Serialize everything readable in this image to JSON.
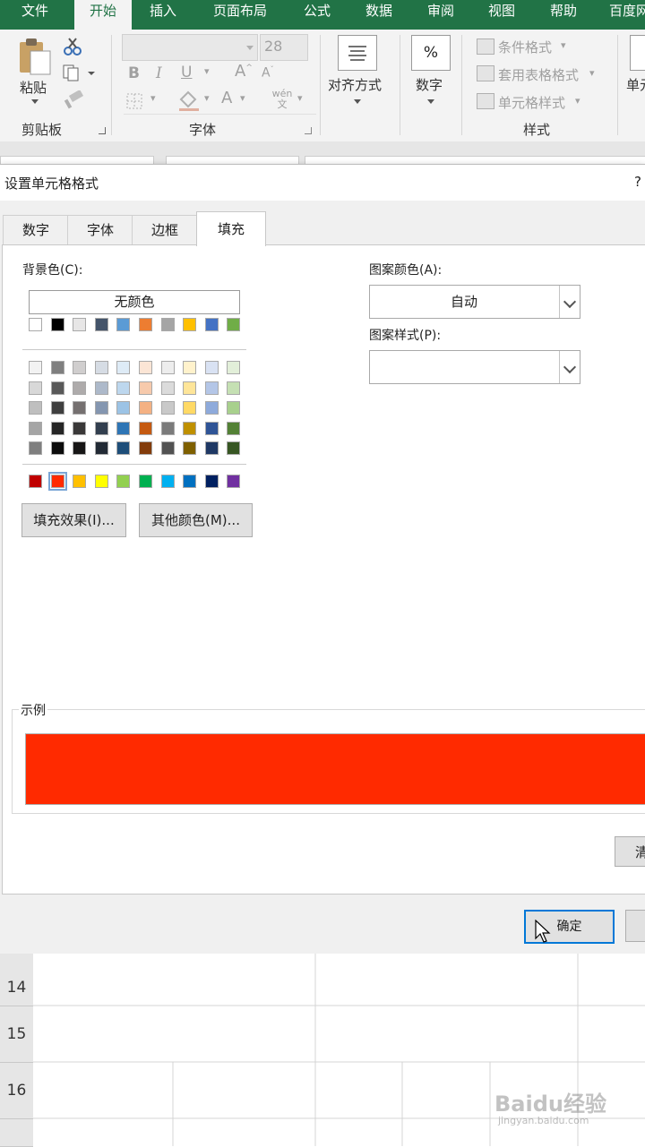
{
  "ribbon": {
    "tabs": [
      "文件",
      "开始",
      "插入",
      "页面布局",
      "公式",
      "数据",
      "审阅",
      "视图",
      "帮助",
      "百度网"
    ],
    "active_tab": "开始",
    "clipboard": {
      "paste_label": "粘贴",
      "group_label": "剪贴板"
    },
    "font": {
      "size_value": "28",
      "group_label": "字体",
      "phonetic_label": "wén 文"
    },
    "alignment": {
      "label": "对齐方式"
    },
    "number": {
      "label": "数字",
      "icon_text": "%"
    },
    "styles": {
      "conditional": "条件格式",
      "table_format": "套用表格格式",
      "cell_styles": "单元格样式",
      "group_label": "样式"
    },
    "cells_partial": "单元"
  },
  "dialog": {
    "title": "设置单元格格式",
    "help": "?",
    "tabs": [
      "数字",
      "字体",
      "边框",
      "填充"
    ],
    "active_tab": "填充",
    "background_color_label": "背景色(C):",
    "no_color_button": "无颜色",
    "fill_effects_button": "填充效果(I)...",
    "more_colors_button": "其他颜色(M)...",
    "pattern_color_label": "图案颜色(A):",
    "pattern_color_value": "自动",
    "pattern_style_label": "图案样式(P):",
    "pattern_style_value": "",
    "sample_label": "示例",
    "sample_color": "#ff2a00",
    "clear_button": "清",
    "ok_button": "确定",
    "palette": {
      "theme_top": [
        "#ffffff",
        "#000000",
        "#e7e6e6",
        "#44546a",
        "#5b9bd5",
        "#ed7d31",
        "#a5a5a5",
        "#ffc000",
        "#4472c4",
        "#70ad47"
      ],
      "shades": [
        [
          "#f2f2f2",
          "#7f7f7f",
          "#d0cece",
          "#d6dce4",
          "#deebf6",
          "#fbe5d5",
          "#ededed",
          "#fff2cc",
          "#d9e2f3",
          "#e2efd9"
        ],
        [
          "#d8d8d8",
          "#595959",
          "#aeabab",
          "#adb9ca",
          "#bdd7ee",
          "#f7caac",
          "#dbdbdb",
          "#fee599",
          "#b4c6e7",
          "#c5e0b3"
        ],
        [
          "#bfbfbf",
          "#3f3f3f",
          "#757070",
          "#8496b0",
          "#9cc3e5",
          "#f4b183",
          "#c9c9c9",
          "#ffd965",
          "#8eaadb",
          "#a8d08d"
        ],
        [
          "#a5a5a5",
          "#262626",
          "#3a3838",
          "#323f4f",
          "#2e75b5",
          "#c55a11",
          "#7b7b7b",
          "#bf9000",
          "#2f5496",
          "#538135"
        ],
        [
          "#7f7f7f",
          "#0c0c0c",
          "#171616",
          "#222a35",
          "#1e4e79",
          "#833c0b",
          "#525252",
          "#7f6000",
          "#1f3864",
          "#375623"
        ]
      ],
      "standard": [
        "#c00000",
        "#ff2a00",
        "#ffc000",
        "#ffff00",
        "#92d050",
        "#00b050",
        "#00b0f0",
        "#0070c0",
        "#002060",
        "#7030a0"
      ],
      "selected_standard_index": 1
    }
  },
  "sheet": {
    "rows": [
      "14",
      "15",
      "16"
    ]
  },
  "watermark": {
    "brand": "Baidu经验",
    "url": "jingyan.baidu.com"
  },
  "colors": {
    "excel_green": "#217346"
  }
}
